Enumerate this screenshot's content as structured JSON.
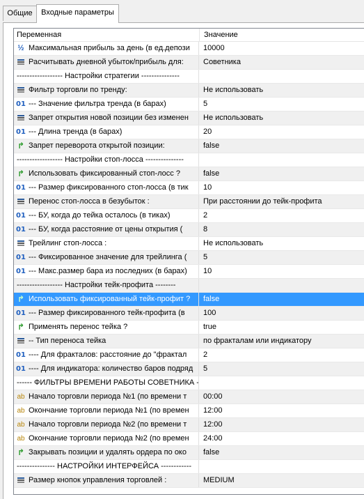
{
  "tabs": [
    {
      "label": "Общие"
    },
    {
      "label": "Входные параметры"
    }
  ],
  "table": {
    "headers": {
      "name": "Переменная",
      "value": "Значение"
    },
    "rows": [
      {
        "icon": "half",
        "name": "Максимальная прибыль за день (в ед.депози",
        "value": "10000"
      },
      {
        "icon": "list",
        "name": "Расчитывать дневной убыток/прибыль для:",
        "value": "Советника"
      },
      {
        "icon": "none",
        "name": "------------------  Настройки стратегии   ---------------",
        "value": ""
      },
      {
        "icon": "list",
        "name": "Фильтр торговли по тренду:",
        "value": "Не использовать"
      },
      {
        "icon": "num",
        "name": "--- Значение фильтра тренда (в барах)",
        "value": "5"
      },
      {
        "icon": "list",
        "name": "Запрет открытия новой позиции без изменен",
        "value": "Не использовать"
      },
      {
        "icon": "num",
        "name": "--- Длина тренда (в барах)",
        "value": "20"
      },
      {
        "icon": "arrow",
        "name": "Запрет переворота открытой позиции:",
        "value": "false"
      },
      {
        "icon": "none",
        "name": "------------------  Настройки стоп-лосса   ---------------",
        "value": ""
      },
      {
        "icon": "arrow",
        "name": "Использовать фиксированный стоп-лосс ?",
        "value": "false"
      },
      {
        "icon": "num",
        "name": "--- Размер фиксированного стоп-лосса (в тик",
        "value": "10"
      },
      {
        "icon": "list",
        "name": "Перенос стоп-лосса в безубыток :",
        "value": "При расстоянии до тейк-профита"
      },
      {
        "icon": "num",
        "name": "--- БУ, когда до тейка осталось (в тиках)",
        "value": "2"
      },
      {
        "icon": "num",
        "name": "--- БУ, когда расстояние от цены открытия (",
        "value": "8"
      },
      {
        "icon": "list",
        "name": "Трейлинг стоп-лосса :",
        "value": "Не использовать"
      },
      {
        "icon": "num",
        "name": "--- Фиксированное значение для трейлинга (",
        "value": "5"
      },
      {
        "icon": "num",
        "name": "--- Макс.размер бара из последних (в барах)",
        "value": "10"
      },
      {
        "icon": "none",
        "name": "------------------  Настройки тейк-профита   --------",
        "value": ""
      },
      {
        "icon": "arrow",
        "name": "Использовать фиксированный тейк-профит ?",
        "value": "false",
        "selected": true
      },
      {
        "icon": "num",
        "name": "--- Размер фиксированного тейк-профита (в",
        "value": "100"
      },
      {
        "icon": "arrow",
        "name": "Применять перенос тейка ?",
        "value": "true"
      },
      {
        "icon": "list",
        "name": "-- Тип переноса тейка",
        "value": "по фракталам или индикатору"
      },
      {
        "icon": "num",
        "name": "---- Для фракталов: расстояние до \"фрактал",
        "value": "2"
      },
      {
        "icon": "num",
        "name": "---- Для индикатора: количество баров подряд",
        "value": "5"
      },
      {
        "icon": "none",
        "name": "------   ФИЛЬТРЫ ВРЕМЕНИ РАБОТЫ СОВЕТНИКА   ---",
        "value": ""
      },
      {
        "icon": "ab",
        "name": "Начало торговли периода №1 (по времени т",
        "value": "00:00"
      },
      {
        "icon": "ab",
        "name": "Окончание торговли периода №1 (по времен",
        "value": "12:00"
      },
      {
        "icon": "ab",
        "name": "Начало торговли периода №2 (по времени т",
        "value": "12:00"
      },
      {
        "icon": "ab",
        "name": "Окончание торговли периода №2 (по времен",
        "value": "24:00"
      },
      {
        "icon": "arrow",
        "name": "Закрывать позиции и удалять ордера по око",
        "value": "false"
      },
      {
        "icon": "none",
        "name": "---------------   НАСТРОЙКИ ИНТЕРФЕЙСА   ------------",
        "value": ""
      },
      {
        "icon": "list",
        "name": "Размер кнопок управления торговлей :",
        "value": "MEDIUM"
      }
    ]
  }
}
